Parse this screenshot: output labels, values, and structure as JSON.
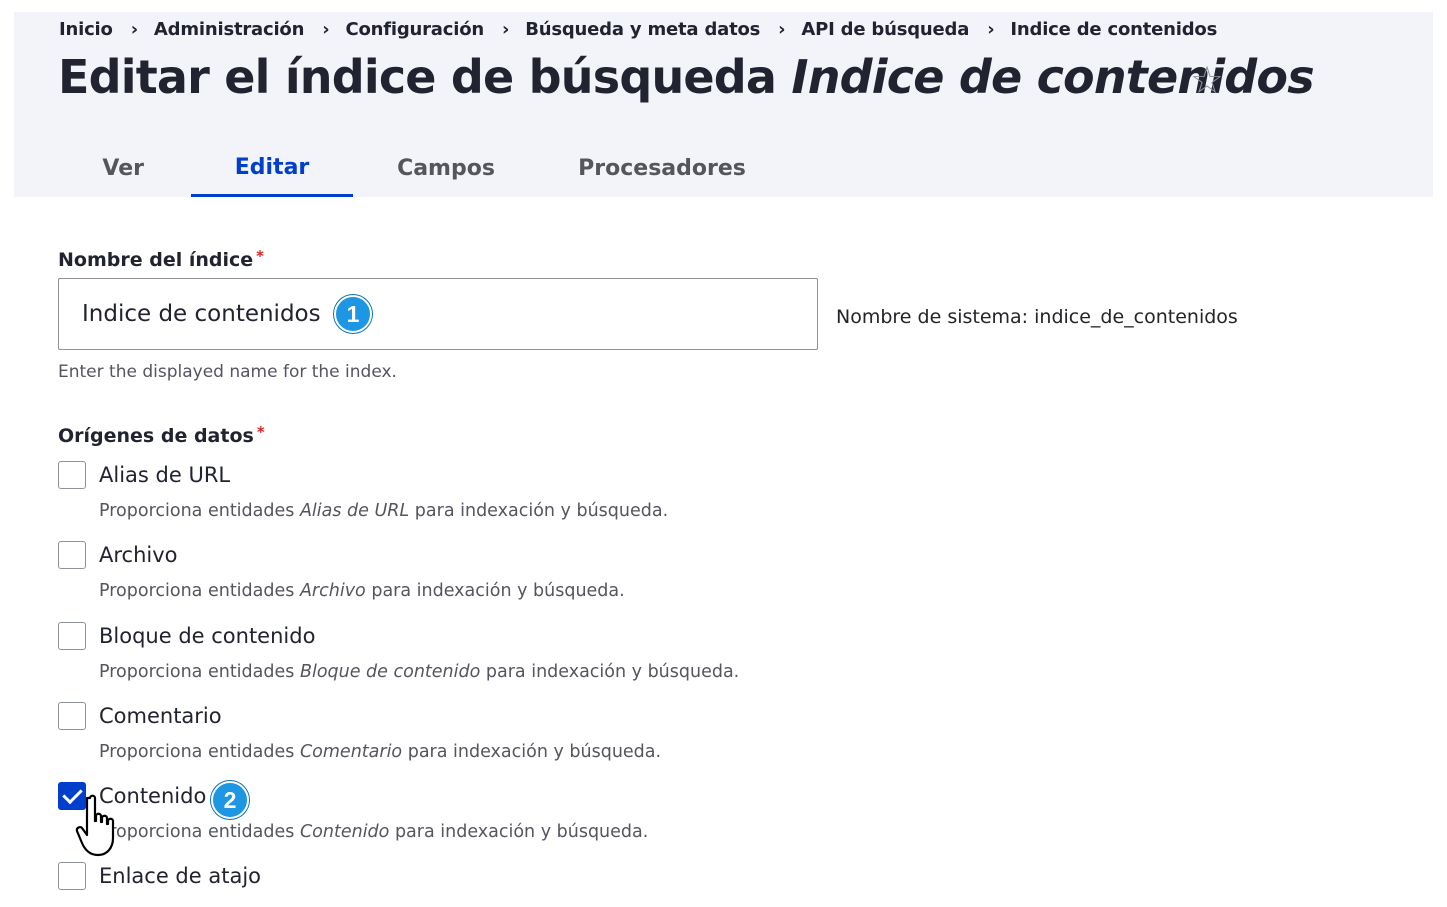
{
  "breadcrumb": [
    "Inicio",
    "Administración",
    "Configuración",
    "Búsqueda y meta datos",
    "API de búsqueda",
    "Indice de contenidos"
  ],
  "breadcrumb_separator": "›",
  "title": {
    "prefix": "Editar el índice de búsqueda",
    "name": "Indice de contenidos",
    "star_icon": "star-outline-icon"
  },
  "tabs": [
    {
      "label": "Ver",
      "active": false
    },
    {
      "label": "Editar",
      "active": true
    },
    {
      "label": "Campos",
      "active": false
    },
    {
      "label": "Procesadores",
      "active": false
    }
  ],
  "index_name": {
    "label": "Nombre del índice",
    "required_mark": "*",
    "value": "Indice de contenidos",
    "machine_name": "Nombre de sistema: indice_de_contenidos",
    "help": "Enter the displayed name for the index."
  },
  "datasources": {
    "label": "Orígenes de datos",
    "required_mark": "*",
    "desc_prefix": "Proporciona entidades",
    "desc_suffix": "para indexación y búsqueda.",
    "items": [
      {
        "label": "Alias de URL",
        "checked": false
      },
      {
        "label": "Archivo",
        "checked": false
      },
      {
        "label": "Bloque de contenido",
        "checked": false
      },
      {
        "label": "Comentario",
        "checked": false
      },
      {
        "label": "Contenido",
        "checked": true
      },
      {
        "label": "Enlace de atajo",
        "checked": false
      }
    ]
  },
  "annotations": {
    "step1": "1",
    "step2": "2"
  },
  "colors": {
    "accent": "#003ecc",
    "header_bg": "#f3f4f9",
    "badge": "#1d96e3",
    "required": "#dc2323"
  }
}
